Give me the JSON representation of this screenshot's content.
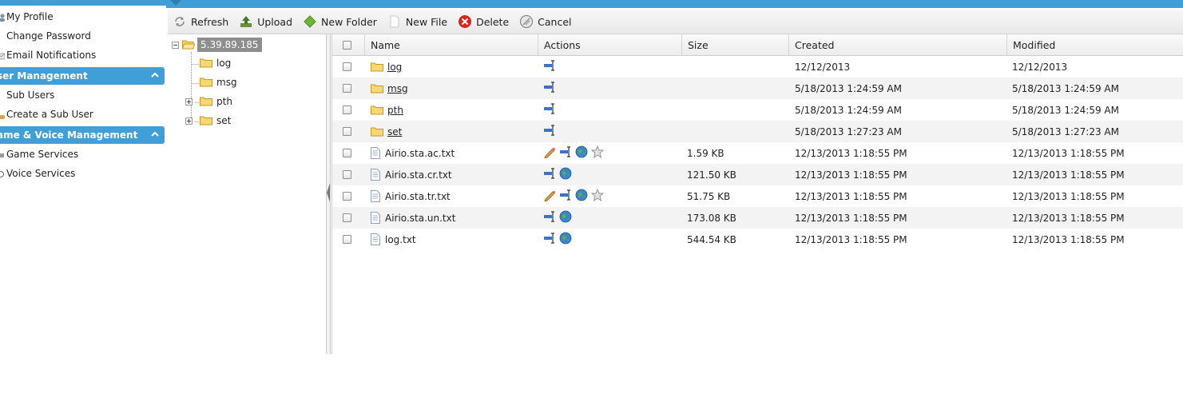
{
  "sidebar": {
    "items_top": [
      {
        "label": "My Profile",
        "icon": "user-icon"
      },
      {
        "label": "Change Password",
        "icon": "key-icon"
      },
      {
        "label": "Email Notifications",
        "icon": "mail-icon"
      }
    ],
    "user_section": {
      "title": "ser Management",
      "items": [
        {
          "label": "Sub Users",
          "icon": "users-icon"
        },
        {
          "label": "Create a Sub User",
          "icon": "user-add-icon"
        }
      ]
    },
    "game_section": {
      "title": "ame & Voice Management",
      "items": [
        {
          "label": "Game Services",
          "icon": "game-icon"
        },
        {
          "label": "Voice Services",
          "icon": "voice-icon"
        }
      ]
    }
  },
  "toolbar": {
    "refresh": "Refresh",
    "upload": "Upload",
    "new_folder": "New Folder",
    "new_file": "New File",
    "delete": "Delete",
    "cancel": "Cancel"
  },
  "tree": {
    "root": "5.39.89.185",
    "children": [
      {
        "label": "log",
        "expandable": false
      },
      {
        "label": "msg",
        "expandable": false
      },
      {
        "label": "pth",
        "expandable": true
      },
      {
        "label": "set",
        "expandable": true
      }
    ]
  },
  "grid": {
    "columns": [
      "Name",
      "Actions",
      "Size",
      "Created",
      "Modified"
    ],
    "rows": [
      {
        "name": "log",
        "type": "folder",
        "actions": [
          "rename"
        ],
        "size": "",
        "created": "12/12/2013",
        "modified": "12/12/2013"
      },
      {
        "name": "msg",
        "type": "folder",
        "actions": [
          "rename"
        ],
        "size": "",
        "created": "5/18/2013 1:24:59 AM",
        "modified": "5/18/2013 1:24:59 AM"
      },
      {
        "name": "pth",
        "type": "folder",
        "actions": [
          "rename"
        ],
        "size": "",
        "created": "5/18/2013 1:24:59 AM",
        "modified": "5/18/2013 1:24:59 AM"
      },
      {
        "name": "set",
        "type": "folder",
        "actions": [
          "rename"
        ],
        "size": "",
        "created": "5/18/2013 1:27:23 AM",
        "modified": "5/18/2013 1:27:23 AM"
      },
      {
        "name": "Airio.sta.ac.txt",
        "type": "file",
        "actions": [
          "edit",
          "rename",
          "web",
          "favorite"
        ],
        "size": "1.59 KB",
        "created": "12/13/2013 1:18:55 PM",
        "modified": "12/13/2013 1:18:55 PM"
      },
      {
        "name": "Airio.sta.cr.txt",
        "type": "file",
        "actions": [
          "rename",
          "web"
        ],
        "size": "121.50 KB",
        "created": "12/13/2013 1:18:55 PM",
        "modified": "12/13/2013 1:18:55 PM"
      },
      {
        "name": "Airio.sta.tr.txt",
        "type": "file",
        "actions": [
          "edit",
          "rename",
          "web",
          "favorite"
        ],
        "size": "51.75 KB",
        "created": "12/13/2013 1:18:55 PM",
        "modified": "12/13/2013 1:18:55 PM"
      },
      {
        "name": "Airio.sta.un.txt",
        "type": "file",
        "actions": [
          "rename",
          "web"
        ],
        "size": "173.08 KB",
        "created": "12/13/2013 1:18:55 PM",
        "modified": "12/13/2013 1:18:55 PM"
      },
      {
        "name": "log.txt",
        "type": "file",
        "actions": [
          "rename",
          "web"
        ],
        "size": "544.54 KB",
        "created": "12/13/2013 1:18:55 PM",
        "modified": "12/13/2013 1:18:55 PM"
      }
    ]
  },
  "colors": {
    "accent": "#3f9fd6",
    "tree_selected": "#8e8e8e",
    "row_alt": "#f3f3f3"
  }
}
